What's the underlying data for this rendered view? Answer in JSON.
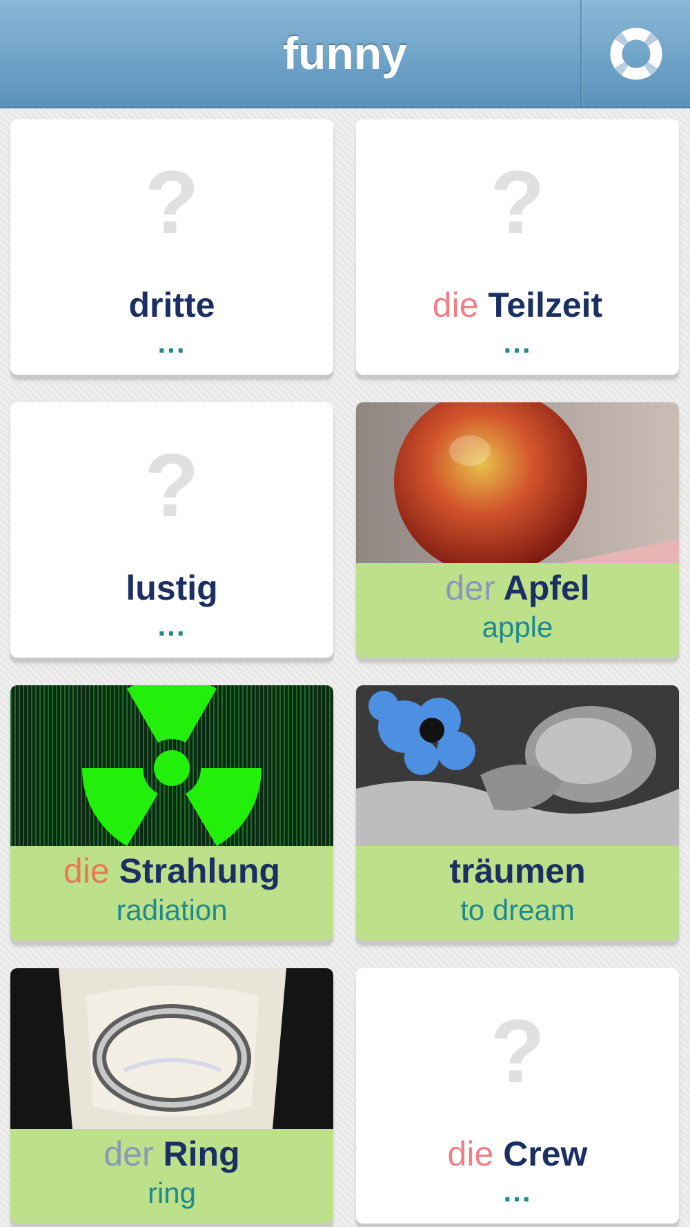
{
  "header": {
    "title": "funny"
  },
  "cards": [
    {
      "article": "",
      "word": "dritte",
      "translation": "..."
    },
    {
      "article": "die",
      "word": "Teilzeit",
      "translation": "..."
    },
    {
      "article": "",
      "word": "lustig",
      "translation": "..."
    },
    {
      "article": "der",
      "word": "Apfel",
      "translation": "apple"
    },
    {
      "article": "die",
      "word": "Strahlung",
      "translation": "radiation"
    },
    {
      "article": "",
      "word": "träumen",
      "translation": "to dream"
    },
    {
      "article": "der",
      "word": "Ring",
      "translation": "ring"
    },
    {
      "article": "die",
      "word": "Crew",
      "translation": "..."
    }
  ],
  "placeholder_glyph": "?",
  "colors": {
    "header": "#6fa3c8",
    "word": "#1b2f63",
    "article_die": "#f07f86",
    "article_der": "#8a97b8",
    "translation": "#1e8a8e",
    "learned_card": "#bde08a"
  }
}
